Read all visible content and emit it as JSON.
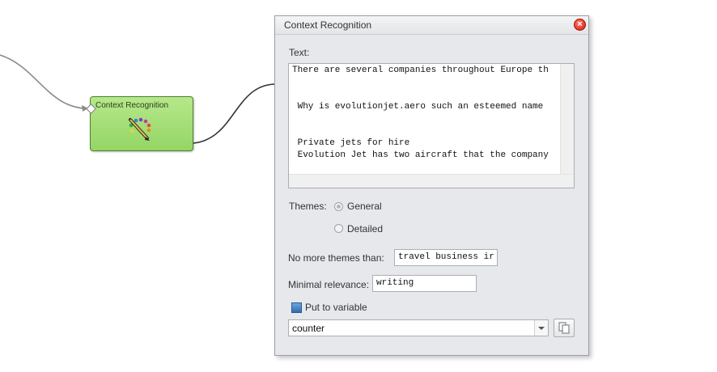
{
  "node": {
    "title": "Context Recognition",
    "icon": "palette-pencil-icon"
  },
  "dialog": {
    "title": "Context Recognition",
    "close_icon": "close-icon",
    "text_label": "Text:",
    "text_lines": [
      "There are several companies throughout Europe th",
      "",
      " Why is evolutionjet.aero such an esteemed name",
      "",
      " Private jets for hire",
      " Evolution Jet has two aircraft that the company"
    ],
    "themes_label": "Themes:",
    "theme_options": [
      {
        "label": "General",
        "checked": true
      },
      {
        "label": "Detailed",
        "checked": false
      }
    ],
    "no_more_themes_label": "No more themes than:",
    "no_more_themes_value": "travel business ir",
    "minimal_relevance_label": "Minimal relevance:",
    "minimal_relevance_value": "writing",
    "put_to_variable_label": "Put to variable",
    "variable_value": "counter",
    "copy_icon": "copy-icon"
  }
}
